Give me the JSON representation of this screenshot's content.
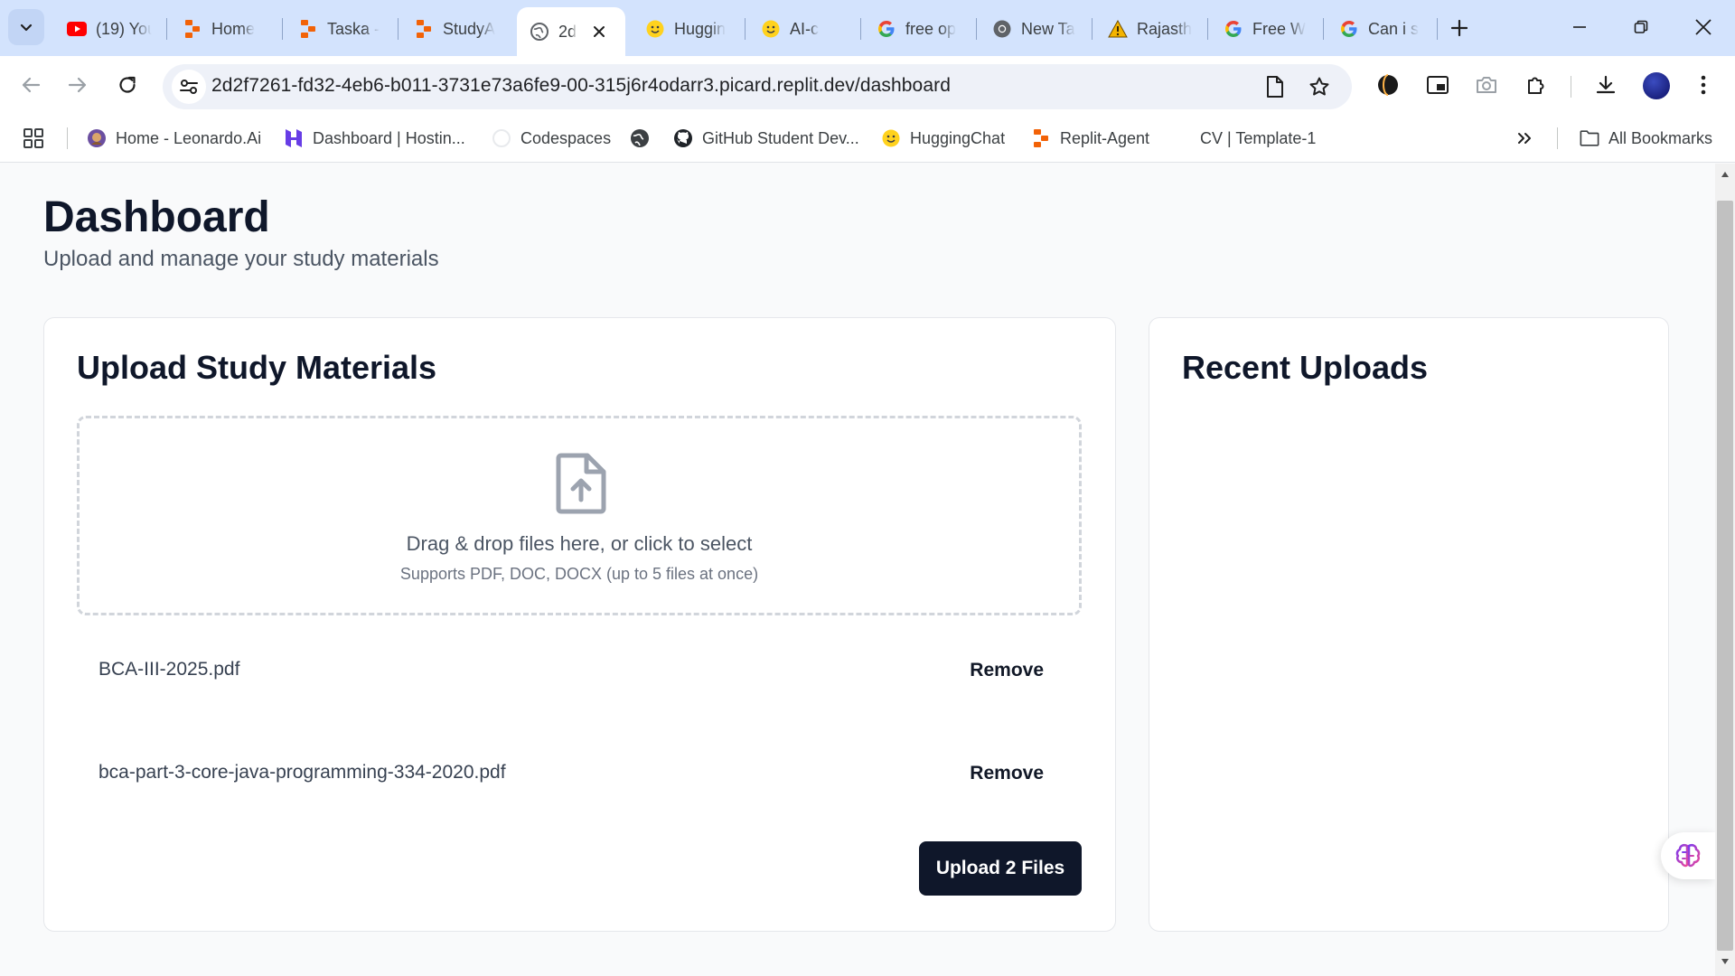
{
  "browser": {
    "tabs": [
      {
        "title": "(19) You",
        "icon": "youtube-icon"
      },
      {
        "title": "Home",
        "icon": "replit-icon"
      },
      {
        "title": "Taska -",
        "icon": "replit-icon"
      },
      {
        "title": "StudyA",
        "icon": "replit-icon"
      },
      {
        "title": "2d",
        "icon": "globe-icon",
        "active": true
      },
      {
        "title": "Huggin",
        "icon": "hugging-face-icon"
      },
      {
        "title": "AI-c",
        "icon": "hugging-face-icon"
      },
      {
        "title": "free op",
        "icon": "google-icon"
      },
      {
        "title": "New Ta",
        "icon": "chrome-icon"
      },
      {
        "title": "Rajasth",
        "icon": "warning-icon"
      },
      {
        "title": "Free W",
        "icon": "google-icon"
      },
      {
        "title": "Can i s",
        "icon": "google-icon"
      }
    ],
    "url": {
      "host": "2d2f7261-fd32-4eb6-b011-3731e73a6fe9-00-315j6r4odarr3.picard.replit.dev",
      "path": "/dashboard"
    },
    "bookmarks": [
      {
        "label": "Home - Leonardo.Ai",
        "icon": "leonardo-icon"
      },
      {
        "label": "Dashboard | Hostin...",
        "icon": "hostinger-icon"
      },
      {
        "label": "Codespaces",
        "icon": "codespaces-icon"
      },
      {
        "label": "",
        "icon": "globe-icon"
      },
      {
        "label": "GitHub Student Dev...",
        "icon": "github-icon"
      },
      {
        "label": "HuggingChat",
        "icon": "hugging-face-icon"
      },
      {
        "label": "Replit-Agent",
        "icon": "replit-icon"
      },
      {
        "label": "CV | Template-1",
        "icon": ""
      }
    ],
    "all_bookmarks_label": "All Bookmarks"
  },
  "page": {
    "title": "Dashboard",
    "subtitle": "Upload and manage your study materials",
    "upload_card": {
      "title": "Upload Study Materials",
      "dropzone_text": "Drag & drop files here, or click to select",
      "dropzone_hint": "Supports PDF, DOC, DOCX (up to 5 files at once)",
      "files": [
        {
          "name": "BCA-III-2025.pdf",
          "action": "Remove"
        },
        {
          "name": "bca-part-3-core-java-programming-334-2020.pdf",
          "action": "Remove"
        }
      ],
      "upload_button": "Upload 2 Files"
    },
    "recent_card": {
      "title": "Recent Uploads"
    }
  },
  "colors": {
    "tab_strip": "#d3e3fd",
    "primary_button": "#0f172a",
    "page_bg": "#f9fafb"
  }
}
